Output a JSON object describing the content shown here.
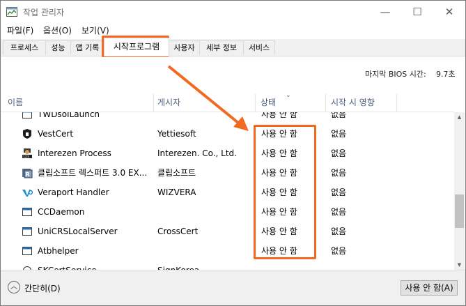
{
  "window": {
    "title": "작업 관리자",
    "minimize_glyph": "—",
    "maximize_glyph": "☐",
    "close_glyph": "✕"
  },
  "menu": {
    "items": [
      "파일(F)",
      "옵션(O)",
      "보기(V)"
    ]
  },
  "tabs": [
    {
      "label": "프로세스"
    },
    {
      "label": "성능"
    },
    {
      "label": "앱 기록"
    },
    {
      "label": "시작프로그램",
      "active": true
    },
    {
      "label": "사용자"
    },
    {
      "label": "세부 정보"
    },
    {
      "label": "서비스"
    }
  ],
  "bios": {
    "label": "마지막 BIOS 시간:",
    "value": "9.7초"
  },
  "columns": [
    "이름",
    "게시자",
    "상태",
    "시작 시 영향"
  ],
  "rows": [
    {
      "name": "TWDsoILaunch",
      "publisher": "",
      "status": "사용 안 함",
      "impact": "없음",
      "icon": "generic-app-icon"
    },
    {
      "name": "VestCert",
      "publisher": "Yettiesoft",
      "status": "사용 안 함",
      "impact": "없음",
      "icon": "vestcert-icon"
    },
    {
      "name": "Interezen Process",
      "publisher": "Interezen. Co., Ltd.",
      "status": "사용 안 함",
      "impact": "없음",
      "icon": "interezen-icon"
    },
    {
      "name": "클립소프트 렉스퍼트 3.0 EX...",
      "publisher": "클립소프트",
      "status": "사용 안 함",
      "impact": "없음",
      "icon": "clipsoft-icon"
    },
    {
      "name": "Veraport Handler",
      "publisher": "WIZVERA",
      "status": "사용 안 함",
      "impact": "없음",
      "icon": "veraport-icon"
    },
    {
      "name": "CCDaemon",
      "publisher": "",
      "status": "사용 안 함",
      "impact": "없음",
      "icon": "generic-app-icon"
    },
    {
      "name": "UniCRSLocalServer",
      "publisher": "CrossCert",
      "status": "사용 안 함",
      "impact": "없음",
      "icon": "generic-app-icon"
    },
    {
      "name": "Atbhelper",
      "publisher": "",
      "status": "사용 안 함",
      "impact": "없음",
      "icon": "generic-app-icon"
    },
    {
      "name": "SKCertService",
      "publisher": "SignKorea",
      "status": "",
      "impact": "",
      "icon": "generic-app-icon"
    }
  ],
  "footer": {
    "collapse_label": "간단히(D)",
    "disable_button": "사용 안 함(A)"
  },
  "colors": {
    "annotation": "#f26a21",
    "header_text": "#4d6082"
  }
}
